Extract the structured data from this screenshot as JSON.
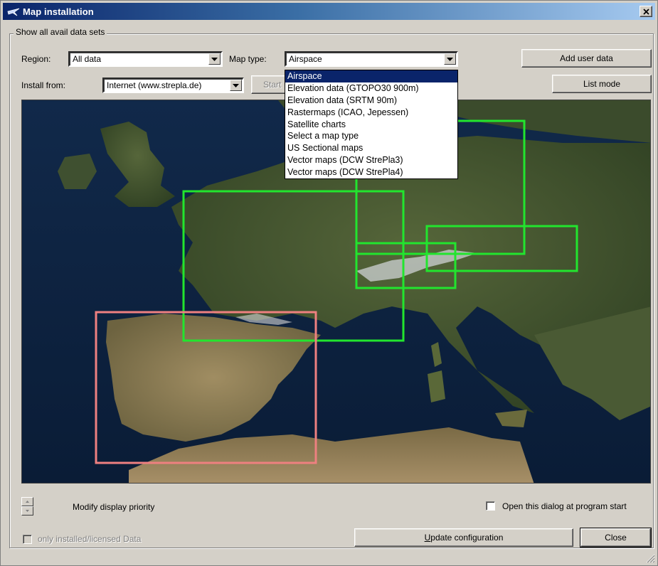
{
  "window": {
    "title": "Map installation",
    "close_label": "✕"
  },
  "group": {
    "legend": "Show all avail data sets"
  },
  "region": {
    "label": "Region:",
    "value": "All data"
  },
  "map_type": {
    "label": "Map type:",
    "value": "Airspace",
    "options": [
      "Airspace",
      "Elevation data (GTOPO30 900m)",
      "Elevation data (SRTM 90m)",
      "Rastermaps (ICAO, Jepessen)",
      "Satellite charts",
      "Select a map type",
      "US Sectional maps",
      "Vector maps (DCW StrePla3)",
      "Vector maps (DCW StrePla4)"
    ],
    "selected_index": 0
  },
  "install_from": {
    "label": "Install from:",
    "value": "Internet (www.strepla.de)"
  },
  "buttons": {
    "start": "Start",
    "add_user_data": "Add user data",
    "list_mode": "List mode",
    "update": "Update configuration",
    "update_accel": "U",
    "update_rest": "pdate configuration",
    "close": "Close"
  },
  "footer": {
    "modify_priority": "Modify display priority",
    "open_at_start": "Open this dialog at program start",
    "only_installed": "only installed/licensed Data"
  },
  "colors": {
    "green_box": "#22e52e",
    "pink_box": "#ee8080",
    "titlebar_start": "#0a246a",
    "selection": "#0a246a"
  },
  "icons": {
    "app": "glider-icon",
    "close": "close-icon",
    "dropdown": "chevron-down-icon",
    "spin_up": "arrow-up-icon",
    "spin_down": "arrow-down-icon",
    "grip": "resize-grip-icon"
  }
}
